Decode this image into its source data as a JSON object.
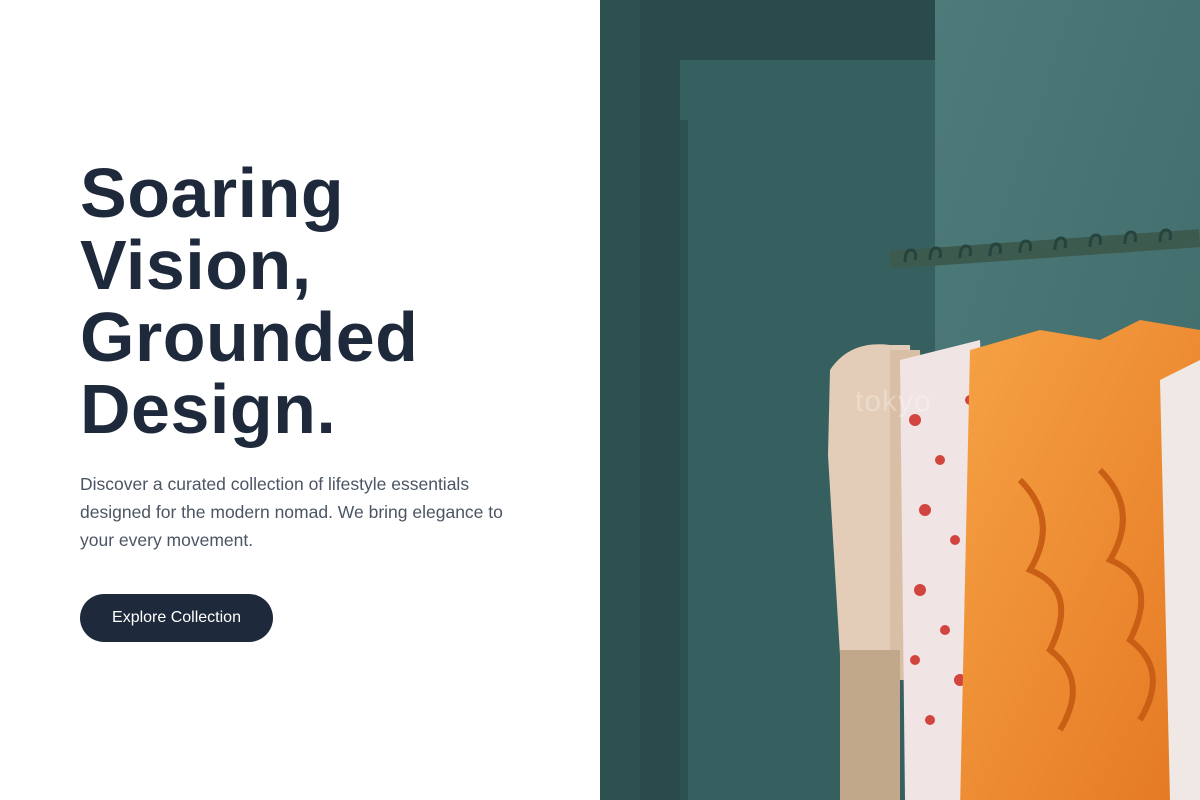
{
  "hero": {
    "title_lines": [
      "Soaring",
      "Vision,",
      "Grounded",
      "Design."
    ],
    "description": "Discover a curated collection of lifestyle essentials designed for the modern nomad. We bring elegance to your every movement.",
    "cta_label": "Explore Collection"
  },
  "image": {
    "subject": "clothing-rack-photo",
    "watermark_text": "tokyo"
  },
  "colors": {
    "heading": "#1e293b",
    "body_text": "#4b5563",
    "button_bg": "#1e293b",
    "button_text": "#ffffff",
    "wall_teal": "#3f6b6a",
    "accent_orange": "#f08a2a"
  }
}
